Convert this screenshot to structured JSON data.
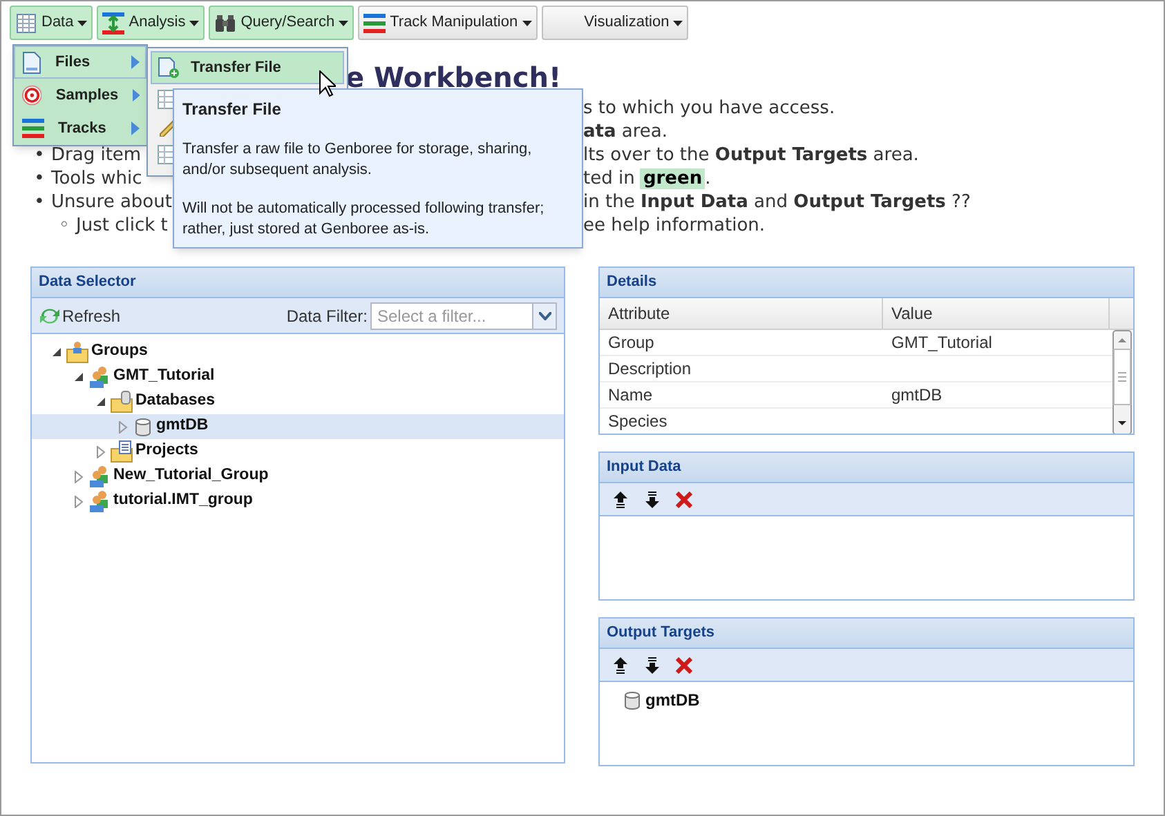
{
  "toolbar": {
    "buttons": [
      {
        "label": "Data",
        "active": true
      },
      {
        "label": "Analysis",
        "active": true
      },
      {
        "label": "Query/Search",
        "active": true
      },
      {
        "label": "Track Manipulation",
        "active": false
      },
      {
        "label": "Visualization",
        "active": false
      }
    ]
  },
  "data_menu": {
    "items": [
      {
        "label": "Files",
        "selected": true
      },
      {
        "label": "Samples",
        "selected": false
      },
      {
        "label": "Tracks",
        "selected": false
      }
    ]
  },
  "files_submenu": {
    "items": [
      {
        "label": "Transfer File",
        "selected": true
      }
    ]
  },
  "tooltip": {
    "title": "Transfer File",
    "paragraphs": [
      "Transfer a raw file to Genboree for storage, sharing, and/or subsequent analysis.",
      "Will not be automatically processed following transfer; rather, just stored at Genboree as-is."
    ]
  },
  "intro": {
    "heading": "e Workbench!",
    "lines": [
      {
        "kind": "bullet",
        "right": "s to which you have access."
      },
      {
        "kind": "bullet",
        "right": "**ata** area."
      },
      {
        "kind": "bullet",
        "marker": "•",
        "left": "Drag item",
        "right": "lts over to the **Output Targets** area."
      },
      {
        "kind": "bullet",
        "marker": "•",
        "left": "Tools whic",
        "right": "ted in ",
        "highlight": "green",
        "tail": "."
      },
      {
        "kind": "bullet",
        "marker": "•",
        "left": "Unsure about",
        "right": "in the **Input Data** and **Output Targets** ??"
      },
      {
        "kind": "sub",
        "marker": "◦",
        "left": "Just click t",
        "right": "ee help information."
      }
    ]
  },
  "data_selector": {
    "title": "Data Selector",
    "refresh": "Refresh",
    "filter_label": "Data Filter:",
    "filter_placeholder": "Select a filter...",
    "tree": [
      {
        "label": "Groups",
        "kind": "groups",
        "expanded": true,
        "selected": false,
        "children": [
          {
            "label": "GMT_Tutorial",
            "kind": "group",
            "expanded": true,
            "selected": false,
            "children": [
              {
                "label": "Databases",
                "kind": "dbfolder",
                "expanded": true,
                "selected": false,
                "children": [
                  {
                    "label": "gmtDB",
                    "kind": "database",
                    "expanded": false,
                    "selected": true
                  }
                ]
              },
              {
                "label": "Projects",
                "kind": "projects",
                "expanded": false,
                "selected": false
              }
            ]
          },
          {
            "label": "New_Tutorial_Group",
            "kind": "group",
            "expanded": false,
            "selected": false
          },
          {
            "label": "tutorial.IMT_group",
            "kind": "group",
            "expanded": false,
            "selected": false
          }
        ]
      }
    ]
  },
  "details": {
    "title": "Details",
    "columns": [
      "Attribute",
      "Value"
    ],
    "rows": [
      {
        "attribute": "Group",
        "value": "GMT_Tutorial"
      },
      {
        "attribute": "Description"
      },
      {
        "attribute": "Name",
        "value": "gmtDB"
      },
      {
        "attribute": "Species"
      }
    ]
  },
  "input_data": {
    "title": "Input Data"
  },
  "output_targets": {
    "title": "Output Targets",
    "items": [
      {
        "label": "gmtDB"
      }
    ]
  }
}
